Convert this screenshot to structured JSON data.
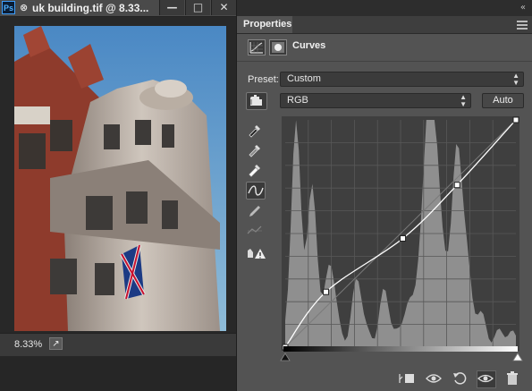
{
  "document": {
    "app_logo": "Ps",
    "title": "uk building.tif @ 8.33...",
    "close_glyph": "⊗",
    "window_controls": [
      "—",
      "□",
      "✕"
    ],
    "zoom": "8.33%"
  },
  "panel": {
    "tab_label": "Properties",
    "adjustment_title": "Curves",
    "preset_label": "Preset:",
    "preset_value": "Custom",
    "channel_value": "RGB",
    "auto_label": "Auto",
    "collapse_glyph": "«"
  },
  "curve": {
    "input_range": [
      0,
      255
    ],
    "output_range": [
      0,
      255
    ],
    "grid_divisions": 10,
    "points": [
      [
        0,
        0
      ],
      [
        45,
        62
      ],
      [
        130,
        122
      ],
      [
        190,
        182
      ],
      [
        255,
        255
      ]
    ],
    "colors": {
      "curve": "#ffffff",
      "histogram": "#8f8f8f",
      "background": "#3f3f3f",
      "grid": "#585858"
    }
  },
  "icons": {
    "tools": [
      "target-adjust",
      "eyedropper-black",
      "eyedropper-gray",
      "eyedropper-white",
      "edit-points",
      "draw-pencil",
      "smooth",
      "clipping-warning"
    ],
    "footer": [
      "clip-to-layer",
      "view-previous",
      "reset",
      "visibility",
      "delete"
    ]
  }
}
